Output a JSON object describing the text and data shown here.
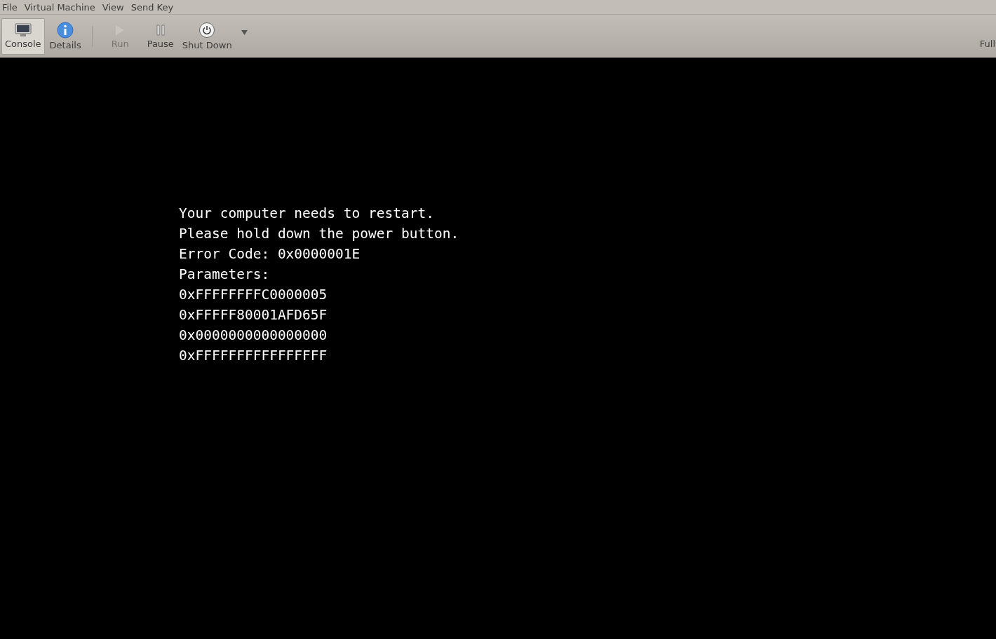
{
  "menu": [
    "File",
    "Virtual Machine",
    "View",
    "Send Key"
  ],
  "toolbar": [
    {
      "label": "Console",
      "kind": "monitor",
      "selected": true,
      "disabled": false
    },
    {
      "label": "Details",
      "kind": "info",
      "selected": false,
      "disabled": false
    },
    {
      "kind": "separator"
    },
    {
      "label": "Run",
      "kind": "play",
      "selected": false,
      "disabled": true
    },
    {
      "label": "Pause",
      "kind": "pause",
      "selected": false,
      "disabled": false
    },
    {
      "label": "Shut Down",
      "kind": "power",
      "selected": false,
      "disabled": false
    },
    {
      "kind": "dropdown"
    }
  ],
  "fullscreen_button": {
    "label": "Full"
  },
  "console": {
    "lines": [
      "Your computer needs to restart.",
      "Please hold down the power button.",
      "Error Code: 0x0000001E",
      "Parameters:",
      "0xFFFFFFFFC0000005",
      "0xFFFFF80001AFD65F",
      "0x0000000000000000",
      "0xFFFFFFFFFFFFFFFF"
    ]
  }
}
